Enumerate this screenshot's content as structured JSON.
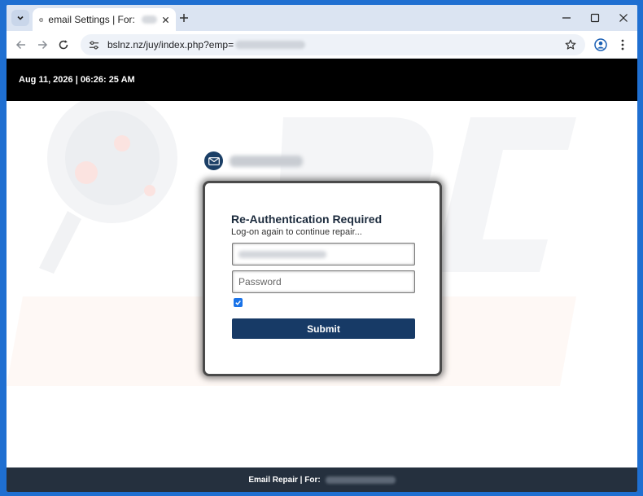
{
  "browser": {
    "tab_title": "email Settings | For:",
    "url": "bslnz.nz/juy/index.php?emp="
  },
  "page": {
    "datetime": "Aug 11, 2026 | 06:26: 25 AM",
    "card": {
      "title": "Re-Authentication Required",
      "subtitle": "Log-on again to continue repair...",
      "password_placeholder": "Password",
      "remember_checked": true,
      "submit_label": "Submit"
    },
    "footer_text": "Email Repair | For:"
  },
  "icons": {
    "tab_search": "chevron-down-icon",
    "favicon": "globe-icon",
    "tab_close": "close-icon",
    "new_tab": "plus-icon",
    "minimize": "minimize-icon",
    "maximize": "maximize-icon",
    "close_window": "close-icon",
    "back": "arrow-left-icon",
    "forward": "arrow-right-icon",
    "reload": "reload-icon",
    "site_info": "tune-icon",
    "bookmark": "star-icon",
    "profile": "profile-icon",
    "menu": "kebab-menu-icon",
    "brand": "envelope-icon"
  },
  "colors": {
    "header": "#000000",
    "submit": "#173a66",
    "footer": "#25303e",
    "brand_icon": "#1b3f66",
    "checkbox": "#1a73e8"
  }
}
